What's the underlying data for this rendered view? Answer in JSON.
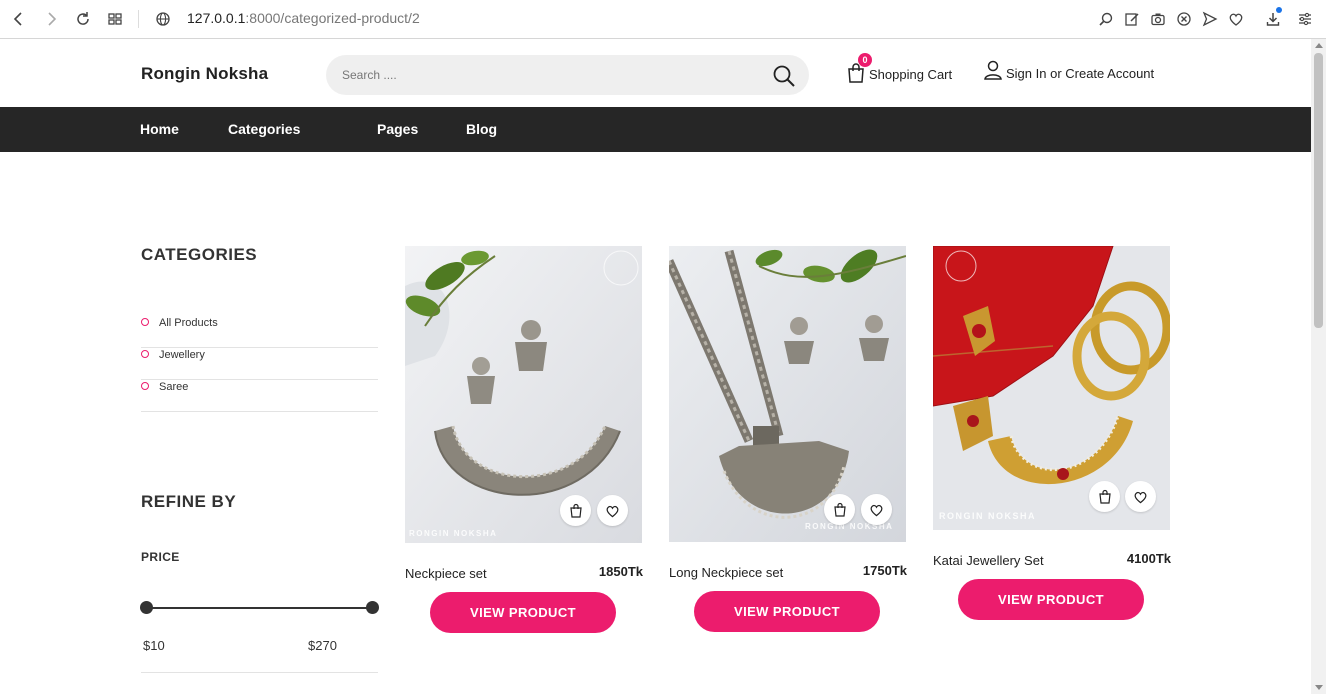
{
  "browser": {
    "url_host": "127.0.0.1",
    "url_path": ":8000/categorized-product/2"
  },
  "header": {
    "logo": "Rongin Noksha",
    "search_placeholder": "Search ....",
    "cart_count": "0",
    "cart_label": "Shopping Cart",
    "account_label": "Sign In or Create Account"
  },
  "nav": {
    "items": [
      "Home",
      "Categories",
      "Pages",
      "Blog"
    ]
  },
  "sidebar": {
    "categories_title": "CATEGORIES",
    "categories": [
      "All Products",
      "Jewellery",
      "Saree"
    ],
    "refine_title": "REFINE BY",
    "price_title": "PRICE",
    "price_min": "$10",
    "price_max": "$270"
  },
  "products": [
    {
      "name": "Neckpiece set",
      "price": "1850Tk",
      "button": "VIEW PRODUCT",
      "watermark": "RONGIN NOKSHA"
    },
    {
      "name": "Long Neckpiece set",
      "price": "1750Tk",
      "button": "VIEW PRODUCT",
      "watermark": "RONGIN NOKSHA"
    },
    {
      "name": "Katai Jewellery Set",
      "price": "4100Tk",
      "button": "VIEW PRODUCT",
      "watermark": "RONGIN NOKSHA"
    }
  ],
  "colors": {
    "accent": "#ec1c6d",
    "nav_bg": "#262626"
  },
  "icons": [
    "back-icon",
    "forward-icon",
    "reload-icon",
    "tabs-grid-icon",
    "globe-icon",
    "zoom-icon",
    "edit-icon",
    "camera-icon",
    "close-circle-icon",
    "send-icon",
    "heart-icon",
    "download-icon",
    "menu-icon",
    "search-icon",
    "cart-icon",
    "user-icon",
    "bag-icon"
  ]
}
